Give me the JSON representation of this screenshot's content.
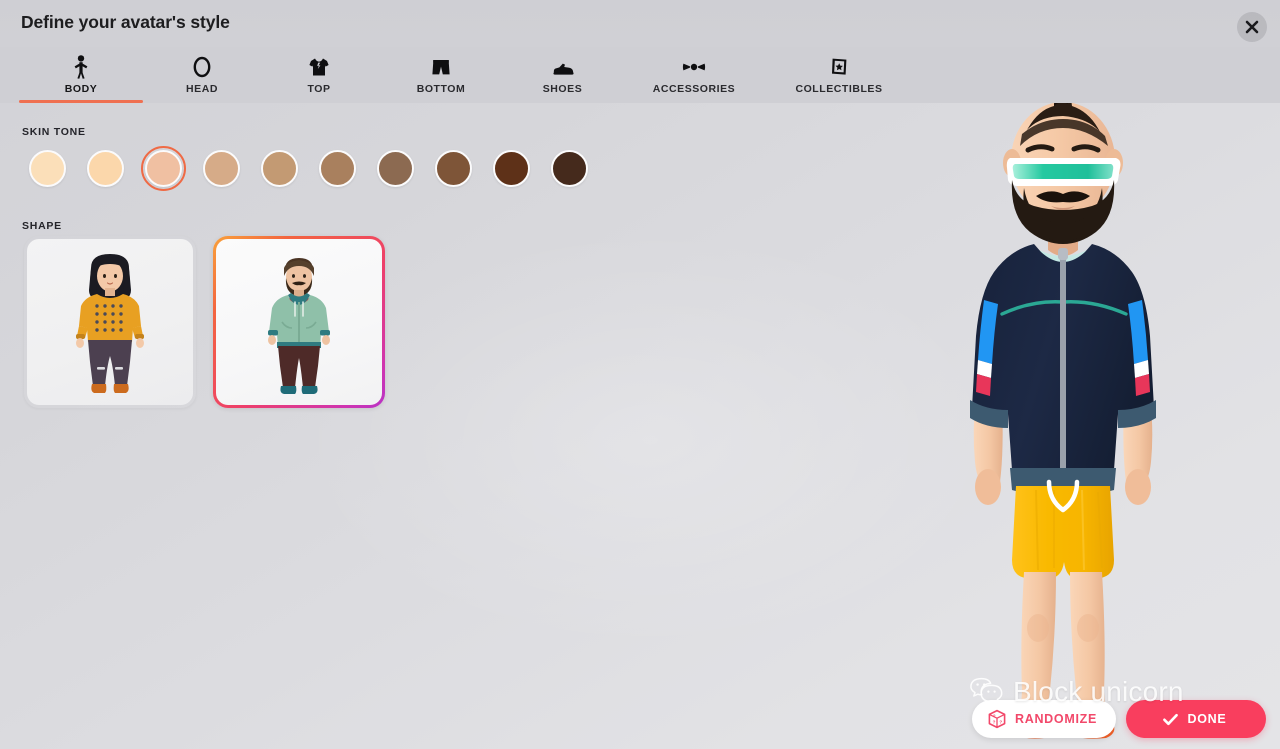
{
  "header": {
    "title": "Define your avatar's style",
    "close_icon": "close-icon"
  },
  "tabs": [
    {
      "label": "BODY",
      "icon": "person-icon",
      "active": true
    },
    {
      "label": "HEAD",
      "icon": "head-oval-icon",
      "active": false
    },
    {
      "label": "TOP",
      "icon": "tshirt-icon",
      "active": false
    },
    {
      "label": "BOTTOM",
      "icon": "shorts-icon",
      "active": false
    },
    {
      "label": "SHOES",
      "icon": "sneaker-icon",
      "active": false
    },
    {
      "label": "ACCESSORIES",
      "icon": "bowtie-icon",
      "active": false
    },
    {
      "label": "COLLECTIBLES",
      "icon": "card-star-icon",
      "active": false
    }
  ],
  "skin_tone": {
    "label": "SKIN TONE",
    "selected_index": 2,
    "selection_ring_color": "#ef6a45",
    "swatches": [
      {
        "color": "#fbdfb9"
      },
      {
        "color": "#fbd7ab"
      },
      {
        "color": "#f0c0a2"
      },
      {
        "color": "#d6ab88"
      },
      {
        "color": "#c39a73"
      },
      {
        "color": "#a9805e"
      },
      {
        "color": "#8c6a51"
      },
      {
        "color": "#7e5538"
      },
      {
        "color": "#5e3118"
      },
      {
        "color": "#452a1c"
      }
    ]
  },
  "shape": {
    "label": "SHAPE",
    "selected_index": 1,
    "selection_gradient": [
      "#f9a23a",
      "#ee3f6a",
      "#b833c6"
    ],
    "options": [
      {
        "name": "feminine-shape",
        "hair": "#1b1b22",
        "skin": "#f3c9a8",
        "top": "#e8a022",
        "top_accent": "#4a4a58",
        "bottom": "#4c4050",
        "shoes": "#cc6b1e"
      },
      {
        "name": "masculine-shape",
        "hair": "#4a3423",
        "skin": "#eec3a2",
        "top": "#8fc0a9",
        "top_accent": "#2f7b80",
        "inner": "#b5474a",
        "bottom": "#4e2a28",
        "shoes": "#1f6b78"
      }
    ]
  },
  "avatar_preview": {
    "name": "avatar-preview",
    "hair_style": "mohawk",
    "hair_color": "#2a1d14",
    "skin_color": "#f5c9a6",
    "beard_color": "#241a12",
    "visor_color": "#25c9a0",
    "visor_frame_color": "#ffffff",
    "jacket_color": "#1d2945",
    "jacket_trim_color": "#3d5a70",
    "jacket_stripe_blue": "#2196f3",
    "jacket_stripe_white": "#ffffff",
    "jacket_stripe_red": "#e8365a",
    "jacket_teal_line": "#2ba894",
    "zipper_color": "#9aa1ab",
    "shirt_color": "#c4e8e4",
    "shorts_color": "#f7b500",
    "drawstring_color": "#ffffff",
    "shoes_color": "#f4622a"
  },
  "actions": {
    "randomize": {
      "label": "RANDOMIZE",
      "icon": "dice-icon",
      "color": "#f2486a"
    },
    "done": {
      "label": "DONE",
      "icon": "check-icon",
      "color": "#ffffff",
      "background": "#f93e5e"
    }
  },
  "watermark": {
    "text": "Block unicorn",
    "icon": "wechat-icon"
  }
}
